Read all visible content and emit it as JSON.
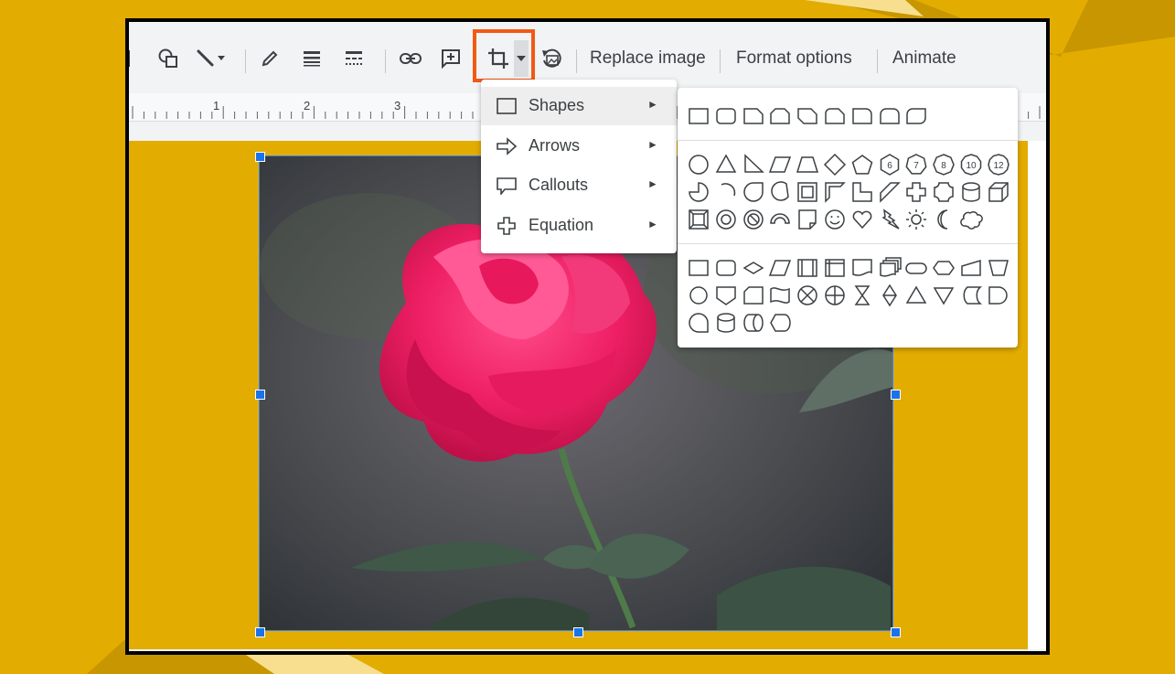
{
  "toolbar": {
    "replace_image_label": "Replace image",
    "format_options_label": "Format options",
    "animate_label": "Animate"
  },
  "ruler": {
    "marks": [
      "1",
      "2",
      "3"
    ]
  },
  "menu": {
    "items": [
      {
        "label": "Shapes",
        "icon": "rectangle-icon",
        "active": true
      },
      {
        "label": "Arrows",
        "icon": "arrow-right-icon",
        "active": false
      },
      {
        "label": "Callouts",
        "icon": "callout-icon",
        "active": false
      },
      {
        "label": "Equation",
        "icon": "plus-equation-icon",
        "active": false
      }
    ]
  },
  "submenu": {
    "rows": [
      [
        "rectangle",
        "rounded-rectangle",
        "snip-corner",
        "snip-same-side",
        "snip-diagonal",
        "round-snip",
        "round-single",
        "round-same-side",
        "round-diagonal"
      ],
      [
        "oval",
        "triangle",
        "right-triangle",
        "parallelogram",
        "trapezoid",
        "diamond",
        "pentagon",
        "hexagon",
        "heptagon",
        "octagon",
        "decagon",
        "dodecagon"
      ],
      [
        "pie",
        "arc",
        "teardrop",
        "chord",
        "frame",
        "half-frame",
        "l-shape",
        "diagonal-stripe",
        "cross",
        "plaque",
        "can",
        "cube"
      ],
      [
        "bevel",
        "donut",
        "no-symbol",
        "block-arc",
        "folded-corner",
        "smiley",
        "heart",
        "lightning",
        "sun",
        "moon",
        "cloud"
      ],
      [
        "flow-process",
        "flow-alt-process",
        "flow-decision",
        "flow-data",
        "flow-predefined",
        "flow-internal-storage",
        "flow-document",
        "flow-multidocument",
        "flow-terminator",
        "flow-preparation",
        "flow-manual-input",
        "flow-manual-operation"
      ],
      [
        "flow-connector",
        "flow-offpage",
        "flow-card",
        "flow-punched-tape",
        "flow-summing",
        "flow-or",
        "flow-collate",
        "flow-sort",
        "flow-extract",
        "flow-merge",
        "flow-stored-data",
        "flow-delay"
      ],
      [
        "flow-sequential",
        "flow-magnetic-disk",
        "flow-direct-access",
        "flow-display"
      ]
    ],
    "polygon_numbers": [
      "6",
      "7",
      "8",
      "10",
      "12"
    ]
  },
  "colors": {
    "background": "#e3ac00",
    "highlight": "#f15a14",
    "selection": "#1a73e8",
    "rose": "#f0246a"
  }
}
